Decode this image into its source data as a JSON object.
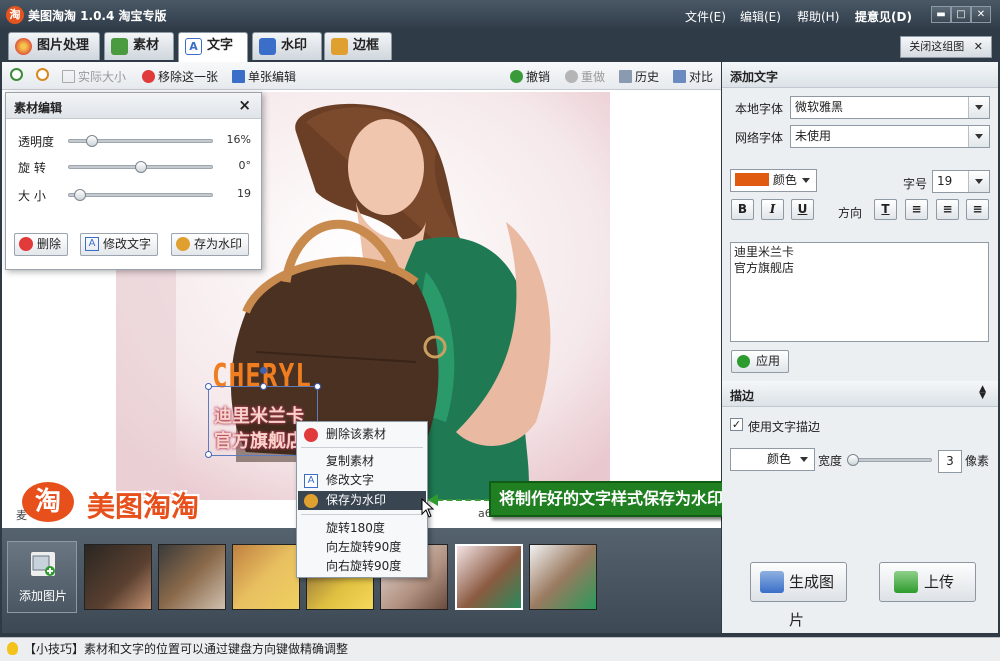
{
  "app": {
    "title": "美图淘淘 1.0.4 淘宝专版",
    "logo_char": "淘"
  },
  "menu": {
    "file": "文件(E)",
    "edit": "编辑(E)",
    "help": "帮助(H)",
    "feedback": "提意见(D)"
  },
  "tabs": [
    {
      "label": "图片处理",
      "color": "#e0563a"
    },
    {
      "label": "素材",
      "color": "#4a9a3f"
    },
    {
      "label": "文字",
      "color": "#3a6ec9"
    },
    {
      "label": "水印",
      "color": "#3a6ec9"
    },
    {
      "label": "边框",
      "color": "#e0a030"
    }
  ],
  "close_group": "关闭这组图",
  "toolbar": {
    "actual_size": "实际大小",
    "remove_one": "移除这一张",
    "single_edit": "单张编辑",
    "undo": "撤销",
    "redo": "重做",
    "history": "历史",
    "compare": "对比"
  },
  "material_panel": {
    "title": "素材编辑",
    "close": "×",
    "sliders": [
      {
        "label": "透明度",
        "value": "16%",
        "fraction": 0.16
      },
      {
        "label": "旋 转",
        "value": "0°",
        "fraction": 0.5
      },
      {
        "label": "大 小",
        "value": "19",
        "fraction": 0.09
      }
    ],
    "buttons": {
      "delete": "删除",
      "edit_text": "修改文字",
      "save_wm": "存为水印"
    }
  },
  "canvas": {
    "cheryl": "CHERYL",
    "wm_line1": "迪里米兰卡",
    "wm_line2": "官方旗舰店",
    "brand_char": "淘",
    "brand_text": "美图淘淘",
    "frag_left": "麦",
    "frag_right": "a6"
  },
  "context_menu": {
    "delete": "删除该素材",
    "copy": "复制素材",
    "edit_text": "修改文字",
    "save_wm": "保存为水印",
    "rot180": "旋转180度",
    "rot_left": "向左旋转90度",
    "rot_right": "向右旋转90度"
  },
  "callout": "将制作好的文字样式保存为水印图",
  "strip": {
    "add_pic": "添加图片"
  },
  "big_buttons": {
    "generate": "生成图片",
    "upload": "上传"
  },
  "right_panel": {
    "add_text_title": "添加文字",
    "local_font_label": "本地字体",
    "local_font_value": "微软雅黑",
    "net_font_label": "网络字体",
    "net_font_value": "未使用",
    "color_label": "颜色",
    "color_value": "#e05a10",
    "size_label": "字号",
    "size_value": "19",
    "bold": "B",
    "italic": "I",
    "underline": "U",
    "direction_label": "方向",
    "text_line1": "迪里米兰卡",
    "text_line2": "官方旗舰店",
    "apply": "应用",
    "stroke_title": "描边",
    "use_stroke": "使用文字描边",
    "stroke_color_label": "颜色",
    "width_label": "宽度",
    "width_value": "3",
    "unit": "像素",
    "check": "✓"
  },
  "status": "【小技巧】素材和文字的位置可以通过键盘方向键做精确调整"
}
